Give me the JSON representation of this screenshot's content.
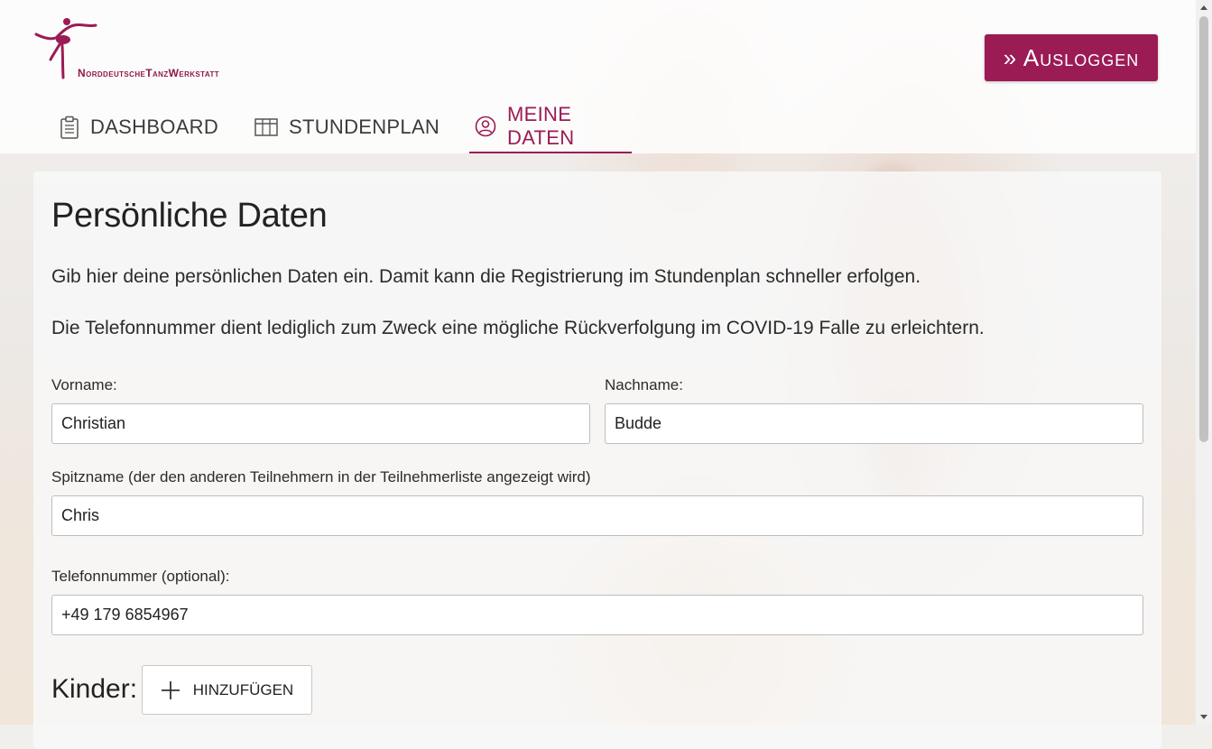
{
  "brand": {
    "logo_text": "NorddeutscheTanzWerkstatt",
    "accent_color": "#9b1b55"
  },
  "header": {
    "logout_label": "» Ausloggen"
  },
  "nav": {
    "tabs": [
      {
        "label": "DASHBOARD",
        "icon": "clipboard-icon",
        "active": false
      },
      {
        "label": "STUNDENPLAN",
        "icon": "table-icon",
        "active": false
      },
      {
        "label": "MEINE DATEN",
        "icon": "user-circle-icon",
        "active": true
      }
    ]
  },
  "main": {
    "title": "Persönliche Daten",
    "intro_1": "Gib hier deine persönlichen Daten ein. Damit kann die Registrierung im Stundenplan schneller erfolgen.",
    "intro_2": "Die Telefonnummer dient lediglich zum Zweck eine mögliche Rückverfolgung im COVID-19 Falle zu erleichtern.",
    "form": {
      "vorname": {
        "label": "Vorname:",
        "value": "Christian"
      },
      "nachname": {
        "label": "Nachname:",
        "value": "Budde"
      },
      "spitzname": {
        "label": "Spitzname (der den anderen Teilnehmern in der Teilnehmerliste angezeigt wird)",
        "value": "Chris"
      },
      "telefon": {
        "label": "Telefonnummer (optional):",
        "value": "+49 179 6854967"
      }
    },
    "kinder": {
      "label": "Kinder:",
      "add_label": "HINZUFÜGEN"
    }
  }
}
